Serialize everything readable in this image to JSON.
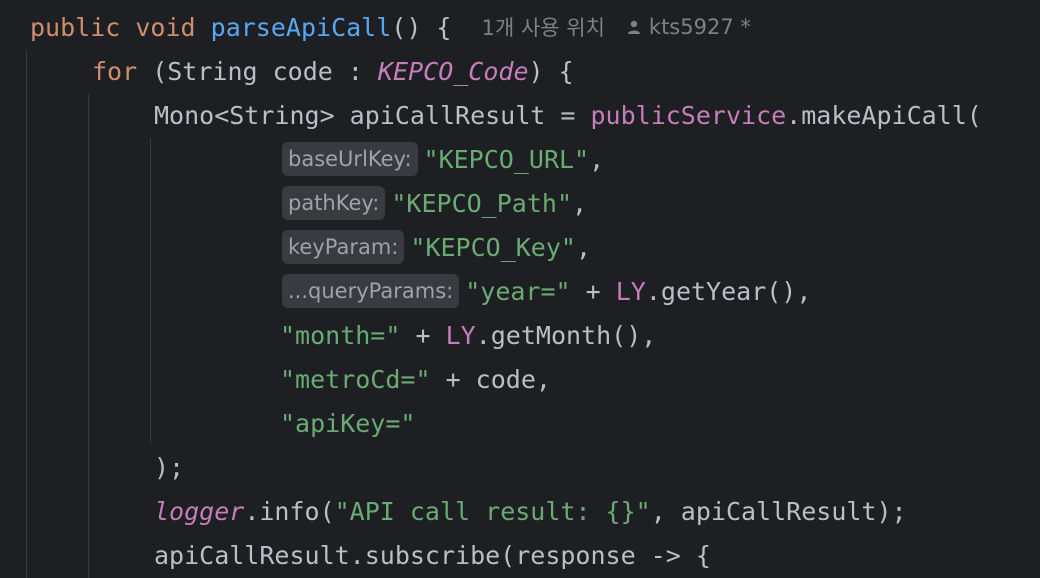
{
  "editor": {
    "lines": [
      {
        "indent": 30,
        "tokens": [
          {
            "t": "public",
            "c": "kw"
          },
          {
            "t": " ",
            "c": "plain"
          },
          {
            "t": "void",
            "c": "kw"
          },
          {
            "t": " ",
            "c": "plain"
          },
          {
            "t": "parseApiCall",
            "c": "fn"
          },
          {
            "t": "() {  ",
            "c": "plain"
          }
        ],
        "usage_hint": "1개 사용 위치",
        "author_hint": "kts5927 *"
      },
      {
        "indent": 92,
        "tokens": [
          {
            "t": "for",
            "c": "kw"
          },
          {
            "t": " (String code : ",
            "c": "plain"
          },
          {
            "t": "KEPCO_Code",
            "c": "konst"
          },
          {
            "t": ") {",
            "c": "plain"
          }
        ]
      },
      {
        "indent": 154,
        "tokens": [
          {
            "t": "Mono<String> apiCallResult = ",
            "c": "plain"
          },
          {
            "t": "publicService",
            "c": "field"
          },
          {
            "t": ".makeApiCall(",
            "c": "plain"
          }
        ]
      },
      {
        "indent": 282,
        "inlay": "baseUrlKey:",
        "tokens": [
          {
            "t": "\"KEPCO_URL\"",
            "c": "str"
          },
          {
            "t": ",",
            "c": "plain"
          }
        ]
      },
      {
        "indent": 282,
        "inlay": "pathKey:",
        "tokens": [
          {
            "t": "\"KEPCO_Path\"",
            "c": "str"
          },
          {
            "t": ",",
            "c": "plain"
          }
        ]
      },
      {
        "indent": 282,
        "inlay": "keyParam:",
        "tokens": [
          {
            "t": "\"KEPCO_Key\"",
            "c": "str"
          },
          {
            "t": ",",
            "c": "plain"
          }
        ]
      },
      {
        "indent": 282,
        "inlay": "...queryParams:",
        "tokens": [
          {
            "t": "\"year=\"",
            "c": "str"
          },
          {
            "t": " + ",
            "c": "plain"
          },
          {
            "t": "LY",
            "c": "field"
          },
          {
            "t": ".getYear(),",
            "c": "plain"
          }
        ]
      },
      {
        "indent": 280,
        "tokens": [
          {
            "t": "\"month=\"",
            "c": "str"
          },
          {
            "t": " + ",
            "c": "plain"
          },
          {
            "t": "LY",
            "c": "field"
          },
          {
            "t": ".getMonth(),",
            "c": "plain"
          }
        ]
      },
      {
        "indent": 280,
        "tokens": [
          {
            "t": "\"metroCd=\"",
            "c": "str"
          },
          {
            "t": " + code,",
            "c": "plain"
          }
        ]
      },
      {
        "indent": 280,
        "tokens": [
          {
            "t": "\"apiKey=\"",
            "c": "str"
          }
        ]
      },
      {
        "indent": 154,
        "tokens": [
          {
            "t": ");",
            "c": "plain"
          }
        ]
      },
      {
        "indent": 154,
        "tokens": [
          {
            "t": "logger",
            "c": "konst"
          },
          {
            "t": ".info(",
            "c": "plain"
          },
          {
            "t": "\"API call result: {}\"",
            "c": "str"
          },
          {
            "t": ", apiCallResult);",
            "c": "plain"
          }
        ]
      },
      {
        "indent": 154,
        "tokens": [
          {
            "t": "apiCallResult.subscribe(response -> {",
            "c": "plain"
          }
        ]
      }
    ]
  },
  "colors": {
    "background": "#1e1f22",
    "keyword": "#cf8e6d",
    "function": "#56a8f5",
    "string": "#6aab73",
    "field": "#c77dbb",
    "text": "#bcbec4",
    "inlay_bg": "#393b40"
  },
  "icons": {
    "author": "person-icon"
  }
}
